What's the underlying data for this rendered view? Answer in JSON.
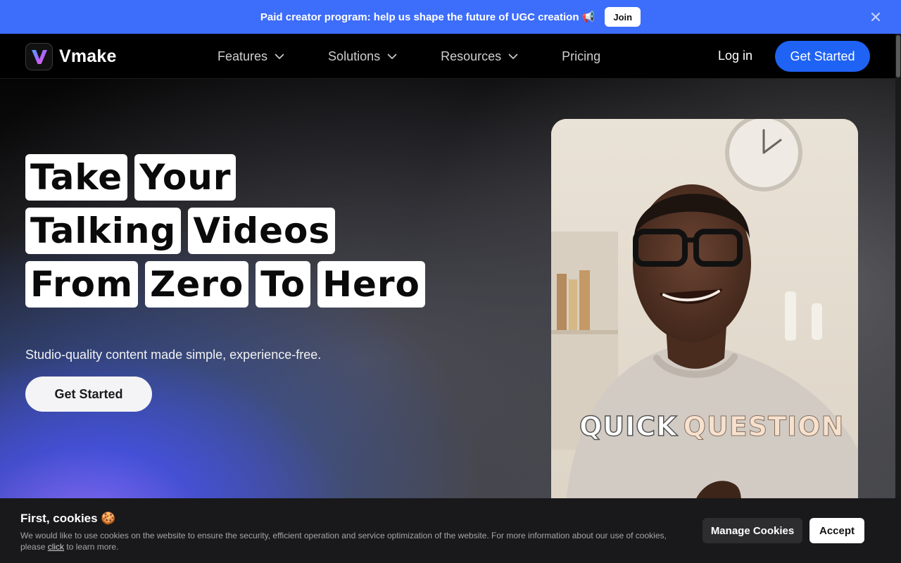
{
  "promo": {
    "text": "Paid creator program: help us shape the future of UGC creation 📢",
    "join_label": "Join",
    "close_icon": "close-icon"
  },
  "nav": {
    "logo_text": "Vmake",
    "items": [
      {
        "label": "Features",
        "has_dropdown": true
      },
      {
        "label": "Solutions",
        "has_dropdown": true
      },
      {
        "label": "Resources",
        "has_dropdown": true
      },
      {
        "label": "Pricing",
        "has_dropdown": false
      }
    ],
    "login_label": "Log in",
    "cta_label": "Get Started"
  },
  "hero": {
    "headline_rows": [
      [
        "Take",
        "Your"
      ],
      [
        "Talking",
        "Videos"
      ],
      [
        "From",
        "Zero",
        "To",
        "Hero"
      ]
    ],
    "subtitle": "Studio-quality content made simple, experience-free.",
    "cta_label": "Get Started"
  },
  "video": {
    "caption_part1": "QUICK",
    "caption_part2": "QUESTION"
  },
  "cookie": {
    "title": "First, cookies 🍪",
    "body_before_link": "We would like to use cookies on the website to ensure the security, efficient operation and service optimization of the website. For more information about our use of cookies, please ",
    "link_text": "click",
    "body_after_link": " to learn more.",
    "manage_label": "Manage Cookies",
    "accept_label": "Accept"
  },
  "colors": {
    "promo_bg": "#3d6dfb",
    "primary_button": "#1f63f5",
    "cookie_bg": "#19191b"
  }
}
